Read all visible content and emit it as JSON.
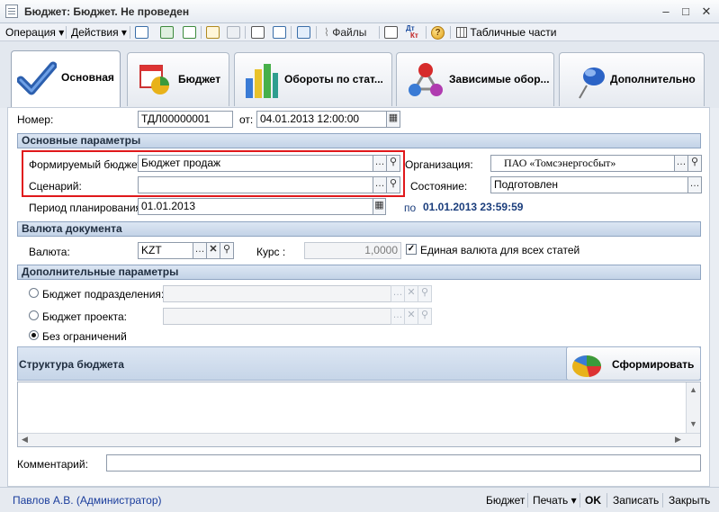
{
  "window": {
    "title": "Бюджет: Бюджет. Не проведен",
    "minimize": "–",
    "maximize": "□",
    "close": "✕"
  },
  "toolbar": {
    "operation": "Операция",
    "actions": "Действия",
    "files": "Файлы",
    "tabular_parts": "Табличные части",
    "dt_kt_top": "Дт",
    "dt_kt_bottom": "Кт",
    "help": "?"
  },
  "tabs": [
    {
      "label": "Основная",
      "icon": "checkmark-icon"
    },
    {
      "label": "Бюджет",
      "icon": "budget-chart-icon"
    },
    {
      "label": "Обороты по стат...",
      "icon": "bar-chart-icon"
    },
    {
      "label": "Зависимые обор...",
      "icon": "molecule-icon"
    },
    {
      "label": "Дополнительно",
      "icon": "pushpin-icon"
    }
  ],
  "form": {
    "number_label": "Номер:",
    "number_value": "ТДЛ00000001",
    "from_label": "от:",
    "date_value": "04.01.2013 12:00:00",
    "section_main": "Основные параметры",
    "budget_label": "Формируемый бюджет:",
    "budget_value": "Бюджет продаж",
    "scenario_label": "Сценарий:",
    "scenario_value": "",
    "org_label": "Организация:",
    "org_value": "ПАО «Томсэнергосбыт»",
    "state_label": "Состояние:",
    "state_value": "Подготовлен",
    "period_label": "Период планирования:",
    "period_value": "01.01.2013",
    "to_label": "по",
    "to_value": "01.01.2013 23:59:59",
    "section_currency": "Валюта документа",
    "currency_label": "Валюта:",
    "currency_value": "KZT",
    "rate_label": "Курс :",
    "rate_value": "1,0000",
    "single_currency_label": "Единая валюта для всех статей",
    "single_currency_checked": true,
    "section_additional": "Дополнительные параметры",
    "dept_budget_label": "Бюджет подразделения:",
    "project_budget_label": "Бюджет проекта:",
    "no_limit_label": "Без ограничений",
    "structure_label": "Структура бюджета",
    "generate_button": "Сформировать",
    "comment_label": "Комментарий:",
    "comment_value": ""
  },
  "footer": {
    "user": "Павлов А.В. (Администратор)",
    "budget": "Бюджет",
    "print": "Печать",
    "ok": "OK",
    "save": "Записать",
    "close": "Закрыть"
  },
  "colors": {
    "highlight_border": "#e0181b",
    "section_header": "#c3d3e7",
    "period_end_text": "#1a3d7c",
    "user_link": "#1a3d9c"
  }
}
